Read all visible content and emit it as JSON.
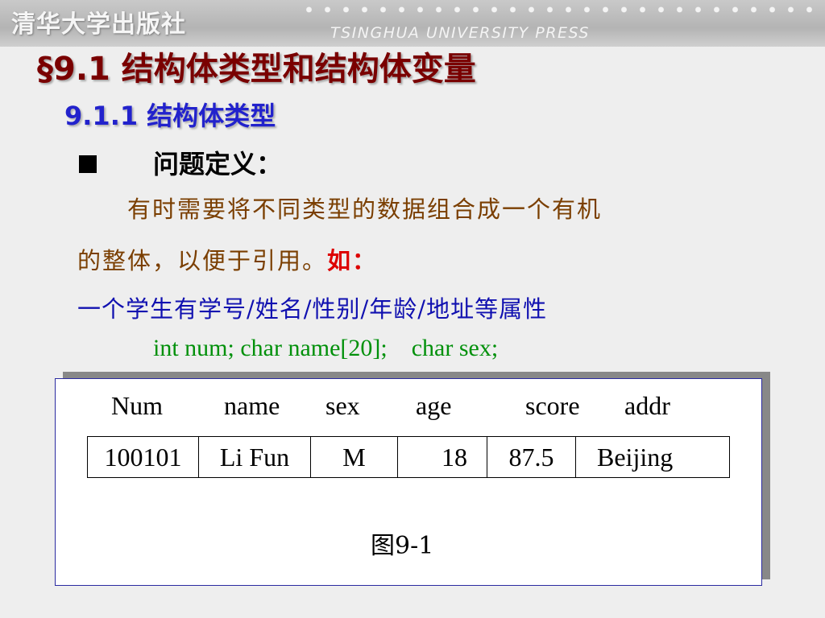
{
  "header": {
    "publisher": "清华大学出版社",
    "publisher_en": "TSINGHUA UNIVERSITY PRESS"
  },
  "slide": {
    "title": "§9.1  结构体类型和结构体变量",
    "subtitle": "9.1.1  结构体类型",
    "bullet_label": "问题定义：",
    "para1": "有时需要将不同类型的数据组合成一个有机",
    "para2": "的整体，以便于引用。",
    "para2_emphasis": "如：",
    "attrs": "一个学生有学号/姓名/性别/年龄/地址等属性",
    "code": "int num; char name[20];    char sex;"
  },
  "figure": {
    "headers": [
      "Num",
      "name",
      "sex",
      "age",
      "score",
      "addr"
    ],
    "cells": [
      "100101",
      "Li Fun",
      "M",
      "18",
      "87.5",
      "Beijing"
    ],
    "caption": "图9-1"
  },
  "colors": {
    "title": "#7a0000",
    "subtitle": "#2222cc",
    "body_text": "#7a3e00",
    "emphasis": "#dd0000",
    "attrs": "#1010b0",
    "code": "#00900a"
  }
}
